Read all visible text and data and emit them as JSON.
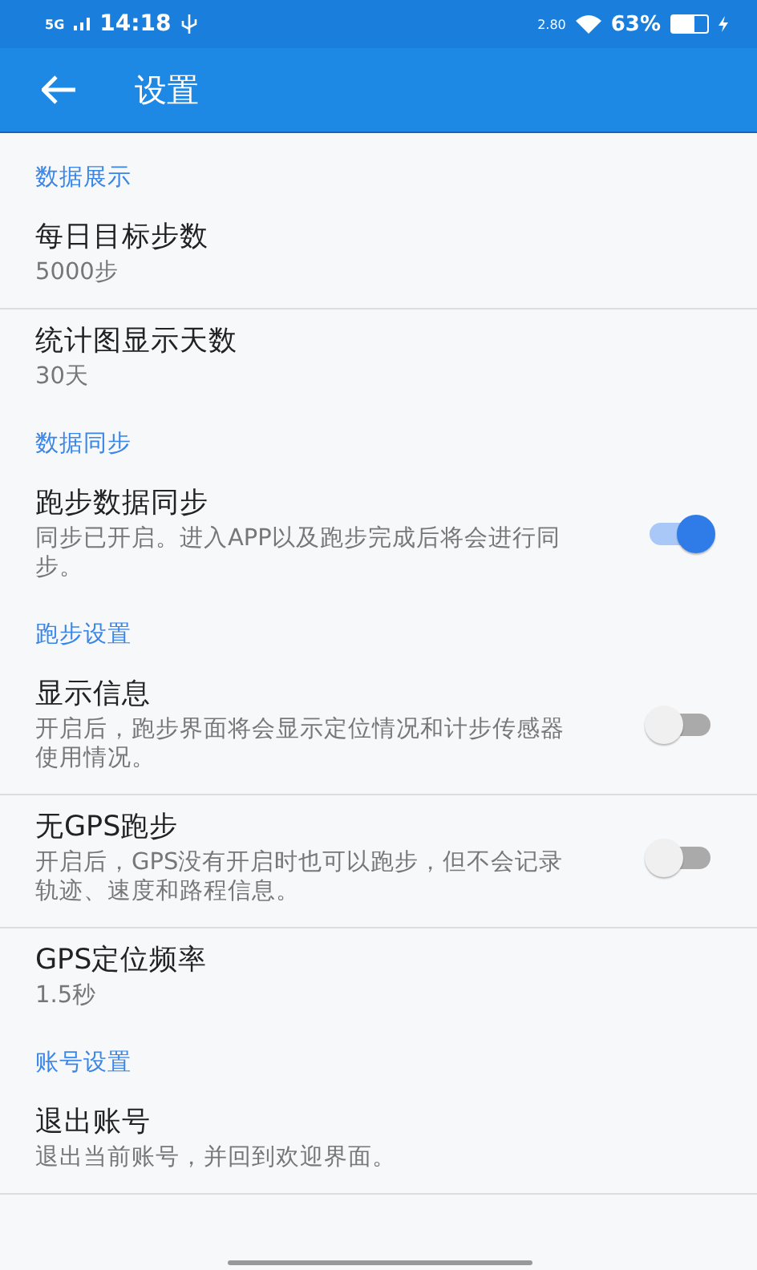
{
  "status_bar": {
    "network": "5G",
    "time": "14:18",
    "speed": "2.80",
    "battery": "63%"
  },
  "app_bar": {
    "title": "设置"
  },
  "sections": [
    {
      "header": "数据展示",
      "items": [
        {
          "kind": "value",
          "title": "每日目标步数",
          "subtitle": "5000步",
          "divider": true
        },
        {
          "kind": "value",
          "title": "统计图显示天数",
          "subtitle": "30天",
          "divider": false
        }
      ]
    },
    {
      "header": "数据同步",
      "items": [
        {
          "kind": "switch",
          "title": "跑步数据同步",
          "subtitle": "同步已开启。进入APP以及跑步完成后将会进行同步。",
          "on": true,
          "divider": false
        }
      ]
    },
    {
      "header": "跑步设置",
      "items": [
        {
          "kind": "switch",
          "title": "显示信息",
          "subtitle": "开启后，跑步界面将会显示定位情况和计步传感器使用情况。",
          "on": false,
          "divider": true
        },
        {
          "kind": "switch",
          "title": "无GPS跑步",
          "subtitle": "开启后，GPS没有开启时也可以跑步，但不会记录轨迹、速度和路程信息。",
          "on": false,
          "divider": true
        },
        {
          "kind": "value",
          "title": "GPS定位频率",
          "subtitle": "1.5秒",
          "divider": false
        }
      ]
    },
    {
      "header": "账号设置",
      "items": [
        {
          "kind": "value",
          "title": "退出账号",
          "subtitle": "退出当前账号，并回到欢迎界面。",
          "divider": true
        }
      ]
    }
  ]
}
